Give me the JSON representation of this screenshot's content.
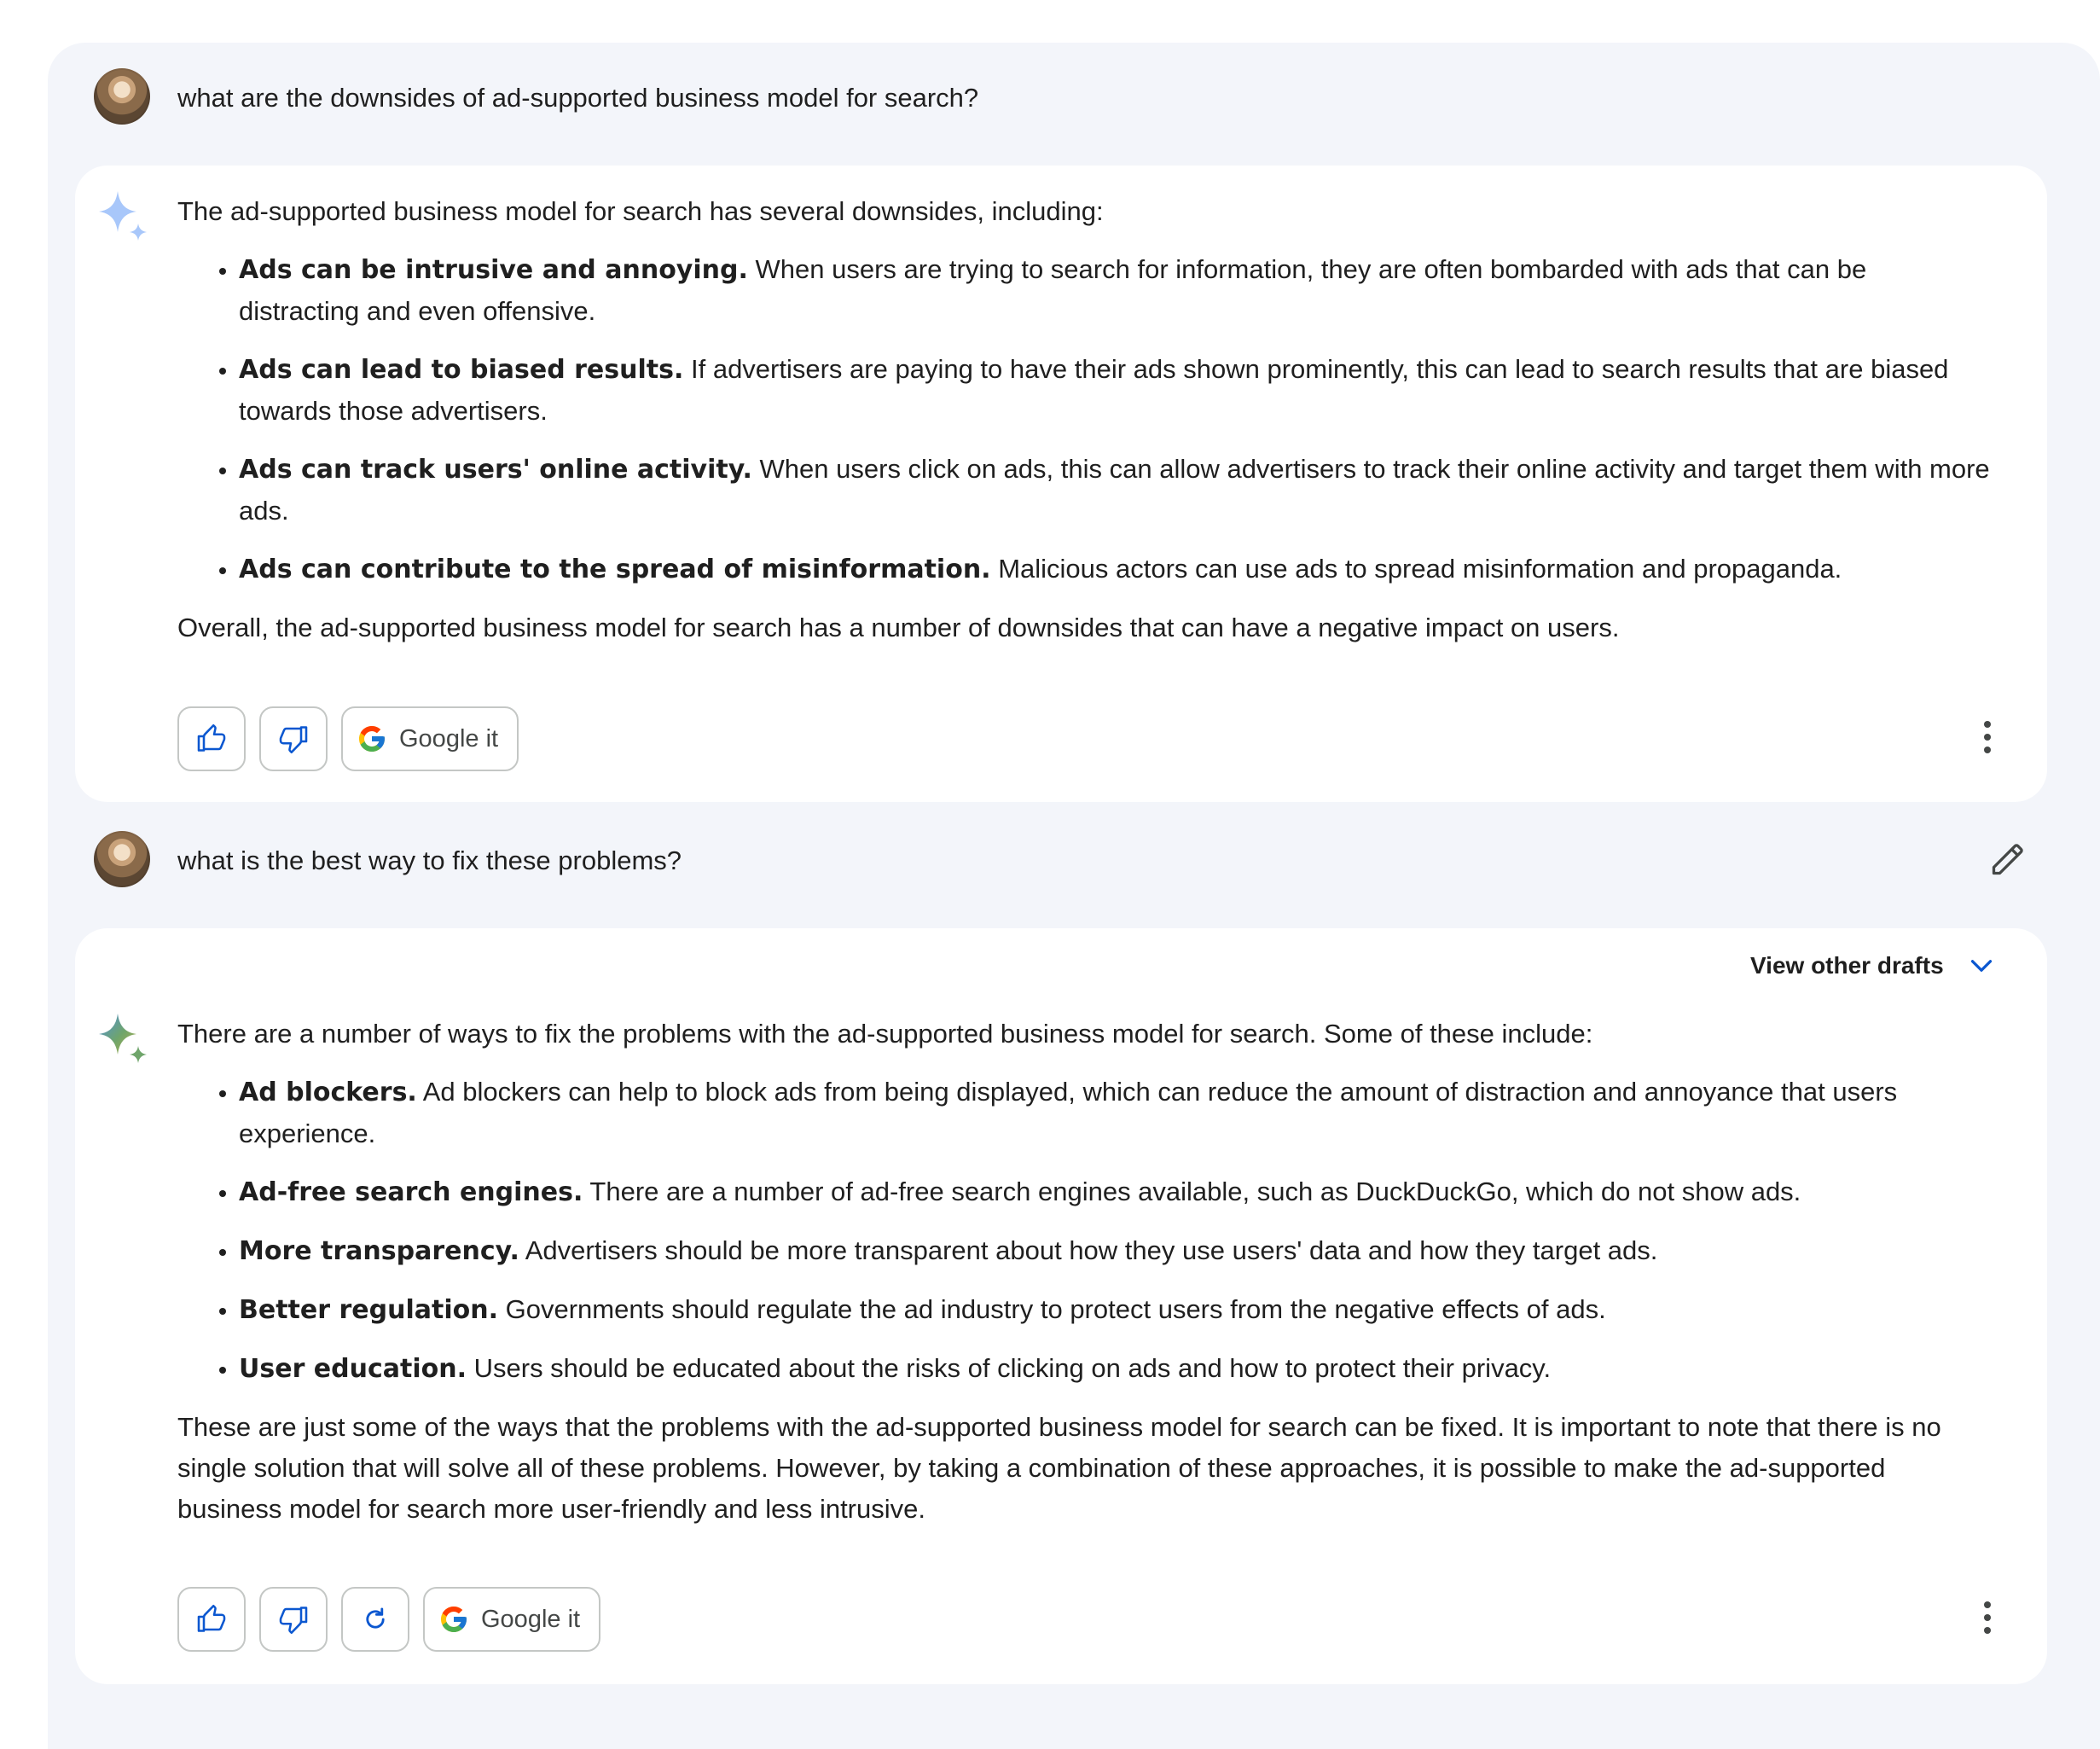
{
  "conversation": {
    "turns": [
      {
        "prompt": "what are the downsides of ad-supported business model for search?",
        "response": {
          "intro": "The ad-supported business model for search has several downsides, including:",
          "bullets": [
            {
              "bold": "Ads can be intrusive and annoying.",
              "text": " When users are trying to search for information, they are often bombarded with ads that can be distracting and even offensive."
            },
            {
              "bold": "Ads can lead to biased results.",
              "text": " If advertisers are paying to have their ads shown prominently, this can lead to search results that are biased towards those advertisers."
            },
            {
              "bold": "Ads can track users' online activity.",
              "text": " When users click on ads, this can allow advertisers to track their online activity and target them with more ads."
            },
            {
              "bold": "Ads can contribute to the spread of misinformation.",
              "text": " Malicious actors can use ads to spread misinformation and propaganda."
            }
          ],
          "conclusion": "Overall, the ad-supported business model for search has a number of downsides that can have a negative impact on users.",
          "google_it_label": "Google it"
        }
      },
      {
        "prompt": "what is the best way to fix these problems?",
        "response": {
          "view_other_drafts_label": "View other drafts",
          "intro": "There are a number of ways to fix the problems with the ad-supported business model for search. Some of these include:",
          "bullets": [
            {
              "bold": "Ad blockers.",
              "text": " Ad blockers can help to block ads from being displayed, which can reduce the amount of distraction and annoyance that users experience."
            },
            {
              "bold": "Ad-free search engines.",
              "text": " There are a number of ad-free search engines available, such as DuckDuckGo, which do not show ads."
            },
            {
              "bold": "More transparency.",
              "text": " Advertisers should be more transparent about how they use users' data and how they target ads."
            },
            {
              "bold": "Better regulation.",
              "text": " Governments should regulate the ad industry to protect users from the negative effects of ads."
            },
            {
              "bold": "User education.",
              "text": " Users should be educated about the risks of clicking on ads and how to protect their privacy."
            }
          ],
          "conclusion": "These are just some of the ways that the problems with the ad-supported business model for search can be fixed. It is important to note that there is no single solution that will solve all of these problems. However, by taking a combination of these approaches, it is possible to make the ad-supported business model for search more user-friendly and less intrusive.",
          "google_it_label": "Google it"
        }
      }
    ]
  },
  "icons": {
    "sparkle_first": "sparkle-icon",
    "sparkle_second": "sparkle-icon",
    "thumbs_up": "thumbs-up-icon",
    "thumbs_down": "thumbs-down-icon",
    "regenerate": "refresh-icon",
    "google": "google-g-icon",
    "more": "more-vertical-icon",
    "edit": "pencil-icon",
    "drafts": "chevron-down-icon"
  },
  "colors": {
    "panel_bg": "#f3f5fa",
    "card_bg": "#ffffff",
    "accent_blue": "#1a73e8",
    "sparkle_blue": "#a8c7fa",
    "text": "#1f1f1f"
  }
}
